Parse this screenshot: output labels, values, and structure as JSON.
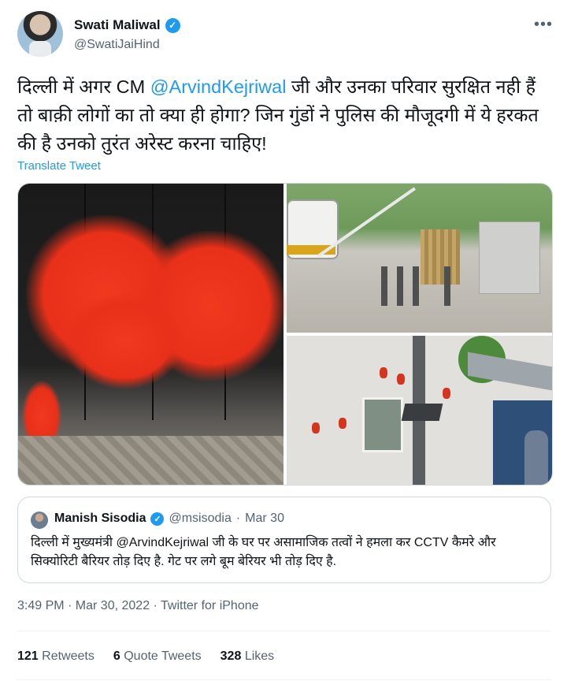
{
  "author": {
    "display_name": "Swati Maliwal",
    "handle": "@SwatiJaiHind",
    "verified_icon": "✓"
  },
  "more_icon": "•••",
  "tweet": {
    "text_before": "दिल्ली में अगर CM ",
    "mention": "@ArvindKejriwal",
    "text_after": " जी और उनका परिवार सुरक्षित नही हैं तो बाक़ी लोगों का तो क्या ही होगा? जिन गुंडों ने पुलिस की मौजूदगी में ये हरकत की है उनको तुरंत अरेस्ट करना चाहिए!"
  },
  "translate_label": "Translate Tweet",
  "quoted_tweet": {
    "display_name": "Manish Sisodia",
    "handle": "@msisodia",
    "separator": "·",
    "date": "Mar 30",
    "verified_icon": "✓",
    "text": "दिल्ली में मुख्यमंत्री @ArvindKejriwal जी के घर पर असामाजिक तत्वों ने हमला कर CCTV कैमरे और सिक्योरिटी बैरियर तोड़ दिए है. गेट पर लगे बूम बेरियर भी तोड़ दिए है."
  },
  "timestamp": "3:49 PM · Mar 30, 2022 · Twitter for iPhone",
  "stats": {
    "retweets_count": "121",
    "retweets_label": "Retweets",
    "quotes_count": "6",
    "quotes_label": "Quote Tweets",
    "likes_count": "328",
    "likes_label": "Likes"
  },
  "colors": {
    "accent": "#1d9bf0",
    "text": "#0f1419",
    "secondary": "#536471",
    "border": "#cfd9de"
  }
}
